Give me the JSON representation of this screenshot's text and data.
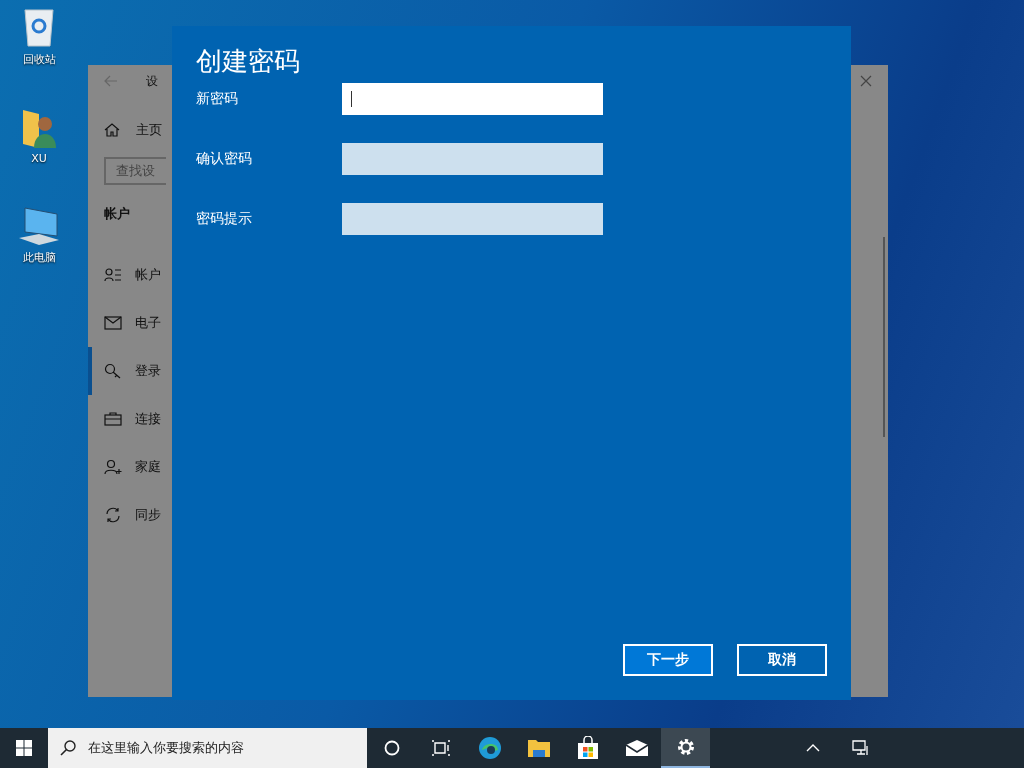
{
  "desktop_icons": [
    {
      "label": "回收站"
    },
    {
      "label": "XU"
    },
    {
      "label": "此电脑"
    }
  ],
  "settings_window": {
    "title": "设",
    "home": "主页",
    "search": {
      "placeholder": "查找设"
    },
    "section": "帐户",
    "items": [
      {
        "label": "帐户",
        "selected": false
      },
      {
        "label": "电子",
        "selected": false
      },
      {
        "label": "登录",
        "selected": true
      },
      {
        "label": "连接",
        "selected": false
      },
      {
        "label": "家庭",
        "selected": false
      },
      {
        "label": "同步",
        "selected": false
      }
    ]
  },
  "dialog": {
    "title": "创建密码",
    "fields": [
      {
        "label": "新密码",
        "focused": true
      },
      {
        "label": "确认密码",
        "focused": false
      },
      {
        "label": "密码提示",
        "focused": false
      }
    ],
    "buttons": [
      {
        "label": "下一步",
        "primary": true
      },
      {
        "label": "取消",
        "primary": false
      }
    ]
  },
  "taskbar": {
    "search": {
      "placeholder": "在这里输入你要搜索的内容"
    },
    "apps": [
      {
        "selected": false
      },
      {
        "selected": false
      },
      {
        "selected": false
      },
      {
        "selected": false
      },
      {
        "selected": false
      },
      {
        "selected": false
      },
      {
        "selected": true
      }
    ]
  }
}
